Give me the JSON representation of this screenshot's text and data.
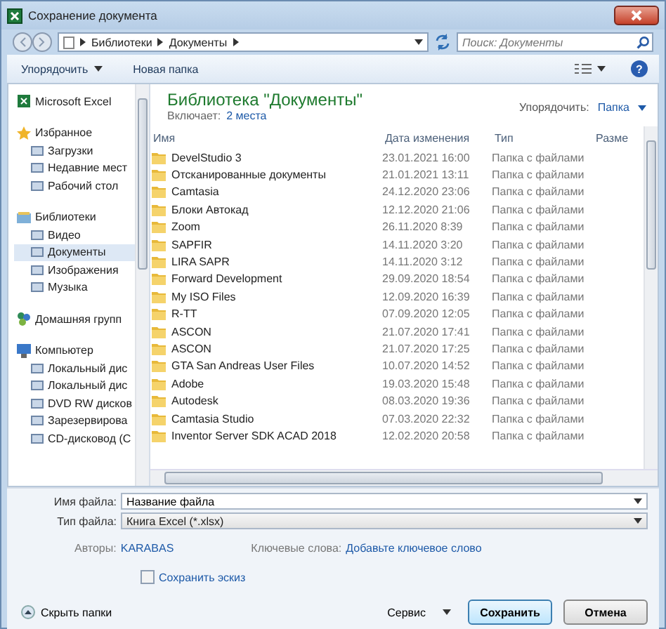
{
  "window": {
    "title": "Сохранение документа"
  },
  "address": {
    "path": [
      "Библиотеки",
      "Документы"
    ],
    "search_placeholder": "Поиск: Документы"
  },
  "toolbar": {
    "organize": "Упорядочить",
    "new_folder": "Новая папка",
    "help": "?"
  },
  "nav": [
    {
      "label": "Microsoft Excel",
      "selected": false
    },
    {
      "label": "Избранное",
      "selected": false,
      "children": [
        {
          "label": "Загрузки",
          "selected": false
        },
        {
          "label": "Недавние мест",
          "selected": false
        },
        {
          "label": "Рабочий стол",
          "selected": false
        }
      ]
    },
    {
      "label": "Библиотеки",
      "selected": false,
      "children": [
        {
          "label": "Видео",
          "selected": false
        },
        {
          "label": "Документы",
          "selected": true
        },
        {
          "label": "Изображения",
          "selected": false
        },
        {
          "label": "Музыка",
          "selected": false
        }
      ]
    },
    {
      "label": "Домашняя групп",
      "selected": false
    },
    {
      "label": "Компьютер",
      "selected": false,
      "children": [
        {
          "label": "Локальный дис",
          "selected": false
        },
        {
          "label": "Локальный дис",
          "selected": false
        },
        {
          "label": "DVD RW дисков",
          "selected": false
        },
        {
          "label": "Зарезервирова",
          "selected": false
        },
        {
          "label": "CD-дисковод (С",
          "selected": false
        }
      ]
    }
  ],
  "library": {
    "title": "Библиотека \"Документы\"",
    "includes_label": "Включает:",
    "includes_link": "2 места",
    "arrange_label": "Упорядочить:",
    "arrange_value": "Папка"
  },
  "table": {
    "columns": [
      "Имя",
      "Дата изменения",
      "Тип",
      "Разме"
    ],
    "rows": [
      {
        "name": "DevelStudio 3",
        "date": "23.01.2021 16:00",
        "type": "Папка с файлами"
      },
      {
        "name": "Отсканированные документы",
        "date": "21.01.2021 13:11",
        "type": "Папка с файлами"
      },
      {
        "name": "Camtasia",
        "date": "24.12.2020 23:06",
        "type": "Папка с файлами"
      },
      {
        "name": "Блоки Автокад",
        "date": "12.12.2020 21:06",
        "type": "Папка с файлами"
      },
      {
        "name": "Zoom",
        "date": "26.11.2020 8:39",
        "type": "Папка с файлами"
      },
      {
        "name": "SAPFIR",
        "date": "14.11.2020 3:20",
        "type": "Папка с файлами"
      },
      {
        "name": "LIRA SAPR",
        "date": "14.11.2020 3:12",
        "type": "Папка с файлами"
      },
      {
        "name": "Forward Development",
        "date": "29.09.2020 18:54",
        "type": "Папка с файлами"
      },
      {
        "name": "My ISO Files",
        "date": "12.09.2020 16:39",
        "type": "Папка с файлами"
      },
      {
        "name": "R-TT",
        "date": "07.09.2020 12:05",
        "type": "Папка с файлами"
      },
      {
        "name": "ASCON",
        "date": "21.07.2020 17:41",
        "type": "Папка с файлами"
      },
      {
        "name": "ASCON",
        "date": "21.07.2020 17:25",
        "type": "Папка с файлами"
      },
      {
        "name": "GTA San Andreas User Files",
        "date": "10.07.2020 14:52",
        "type": "Папка с файлами"
      },
      {
        "name": "Adobe",
        "date": "19.03.2020 15:48",
        "type": "Папка с файлами"
      },
      {
        "name": "Autodesk",
        "date": "08.03.2020 19:36",
        "type": "Папка с файлами"
      },
      {
        "name": "Camtasia Studio",
        "date": "07.03.2020 22:32",
        "type": "Папка с файлами"
      },
      {
        "name": "Inventor Server SDK ACAD 2018",
        "date": "12.02.2020 20:58",
        "type": "Папка с файлами"
      }
    ]
  },
  "form": {
    "filename_label": "Имя файла:",
    "filename_value": "Название файла",
    "filetype_label": "Тип файла:",
    "filetype_value": "Книга Excel (*.xlsx)",
    "authors_label": "Авторы:",
    "authors_value": "KARABAS",
    "keywords_label": "Ключевые слова:",
    "keywords_value": "Добавьте ключевое слово",
    "thumbnail_label": "Сохранить эскиз",
    "thumbnail_checked": false
  },
  "footer": {
    "hide_folders": "Скрыть папки",
    "service": "Сервис",
    "save": "Сохранить",
    "cancel": "Отмена"
  }
}
